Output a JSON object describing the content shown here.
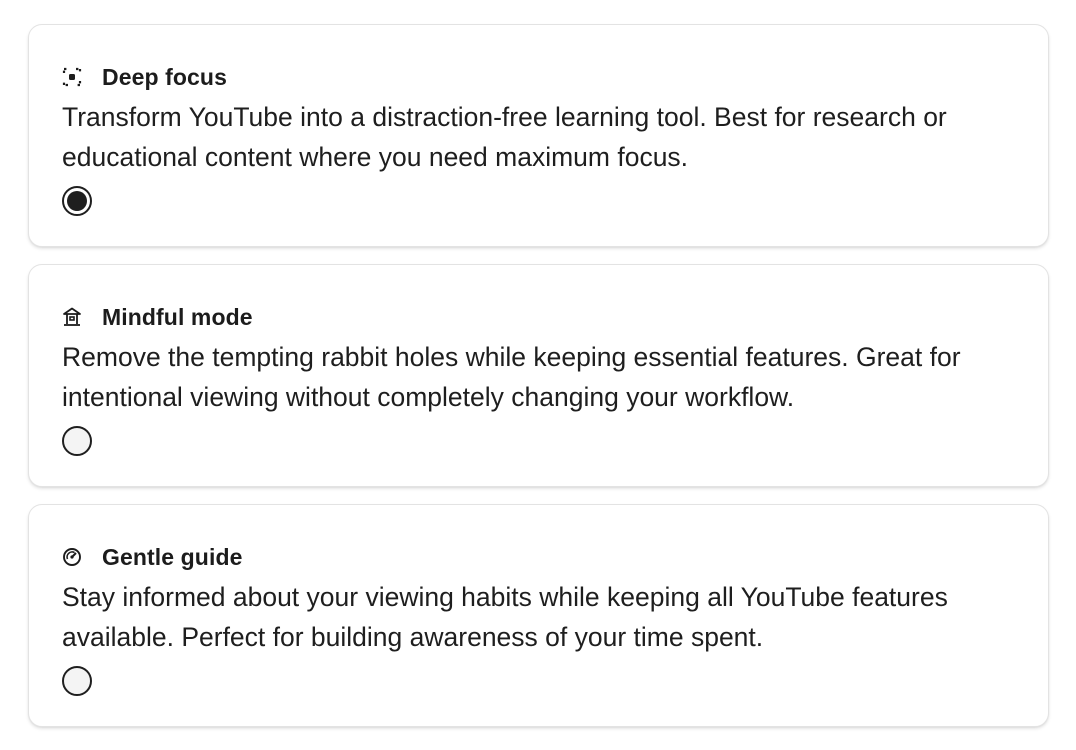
{
  "options": [
    {
      "title": "Deep focus",
      "icon": "focus-frame-icon",
      "description": "Transform YouTube into a distraction-free learning tool. Best for research or educational content where you need maximum focus.",
      "selected": true
    },
    {
      "title": "Mindful mode",
      "icon": "temple-icon",
      "description": "Remove the tempting rabbit holes while keeping essential features. Great for intentional viewing without completely changing your workflow.",
      "selected": false
    },
    {
      "title": "Gentle guide",
      "icon": "gauge-icon",
      "description": "Stay informed about your viewing habits while keeping all YouTube features available. Perfect for building awareness of your time spent.",
      "selected": false
    }
  ],
  "colors": {
    "text": "#1c1c1c",
    "border": "#e3e3e3",
    "radio_fill": "#1f1f1f"
  }
}
